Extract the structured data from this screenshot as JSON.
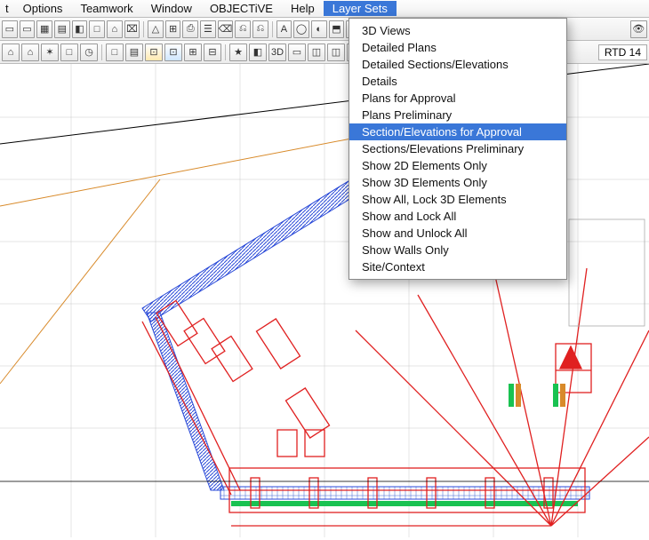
{
  "menubar": {
    "items": [
      {
        "label": "t"
      },
      {
        "label": "Options"
      },
      {
        "label": "Teamwork"
      },
      {
        "label": "Window"
      },
      {
        "label": "OBJECTiVE"
      },
      {
        "label": "Help"
      },
      {
        "label": "Layer Sets",
        "active": true
      }
    ]
  },
  "dropdown": {
    "items": [
      {
        "label": "3D Views"
      },
      {
        "label": "Detailed Plans"
      },
      {
        "label": "Detailed Sections/Elevations"
      },
      {
        "label": "Details"
      },
      {
        "label": "Plans for Approval"
      },
      {
        "label": "Plans Preliminary"
      },
      {
        "label": "Section/Elevations for Approval",
        "selected": true
      },
      {
        "label": "Sections/Elevations Preliminary"
      },
      {
        "label": "Show 2D Elements Only"
      },
      {
        "label": "Show 3D Elements Only"
      },
      {
        "label": "Show All, Lock 3D Elements"
      },
      {
        "label": "Show and Lock All"
      },
      {
        "label": "Show and Unlock All"
      },
      {
        "label": "Show Walls Only"
      },
      {
        "label": "Site/Context"
      }
    ]
  },
  "toolbar": {
    "row1_icons": [
      "▭",
      "▭",
      "▦",
      "▤",
      "◧",
      "□",
      "⌂",
      "⌧",
      "△",
      "⊞",
      "⎙",
      "☰",
      "⌫",
      "⎌",
      "⎌",
      "‖",
      "A",
      "◯",
      "◐",
      "⬒",
      "◨",
      "△"
    ],
    "row2_icons": [
      "⌂",
      "⌂",
      "✶",
      "□",
      "◷",
      "",
      "□",
      "▤",
      "⊡",
      "⊡",
      "⊞",
      "⊟",
      "★",
      "◧",
      "3D",
      "▭",
      "◫",
      "◫",
      "⌂"
    ],
    "right_label": "RTD 14"
  },
  "drawing": {
    "grid_visible": true,
    "colors": {
      "grid": "#9e9e9e",
      "black_line": "#000000",
      "orange_line": "#d88a2a",
      "red_line": "#e02020",
      "blue_hatch": "#2a4ad8",
      "green_fill": "#19c251"
    }
  }
}
